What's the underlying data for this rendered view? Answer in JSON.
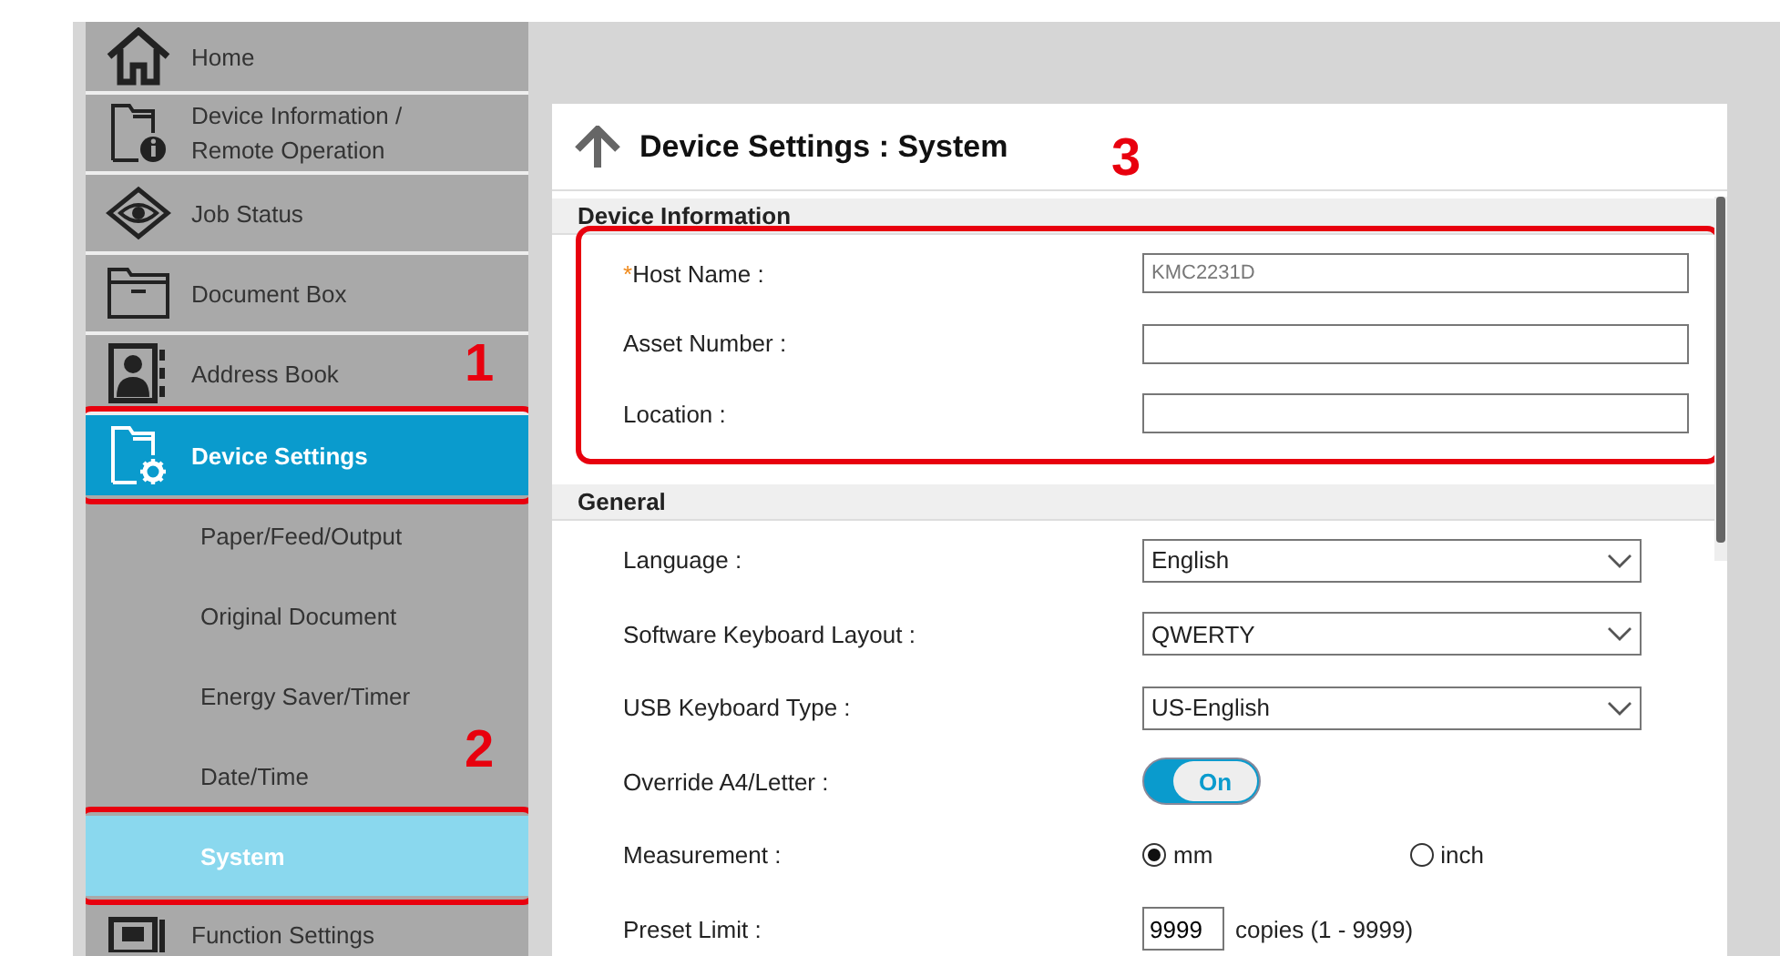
{
  "sidebar": {
    "items": [
      {
        "label": "Home",
        "selected": false
      },
      {
        "label": "Device Information / Remote Operation",
        "selected": false
      },
      {
        "label": "Job Status",
        "selected": false
      },
      {
        "label": "Document Box",
        "selected": false
      },
      {
        "label": "Address Book",
        "selected": false
      },
      {
        "label": "Device Settings",
        "selected": true,
        "callout": "1",
        "children": [
          {
            "label": "Paper/Feed/Output",
            "selected": false
          },
          {
            "label": "Original Document",
            "selected": false
          },
          {
            "label": "Energy Saver/Timer",
            "selected": false
          },
          {
            "label": "Date/Time",
            "selected": false
          },
          {
            "label": "System",
            "selected": true,
            "callout": "2"
          }
        ]
      },
      {
        "label": "Function Settings",
        "selected": false
      }
    ]
  },
  "panel": {
    "title": "Device Settings : System",
    "sections": [
      {
        "title": "Device Information",
        "callout": "3",
        "rows": [
          {
            "kind": "text",
            "label": "Host Name :",
            "required_mark": "*",
            "value": "KMC2231D"
          },
          {
            "kind": "text",
            "label": "Asset Number :"
          },
          {
            "kind": "text",
            "label": "Location :"
          }
        ]
      },
      {
        "title": "General",
        "rows": [
          {
            "kind": "select",
            "label": "Language :",
            "value": "English"
          },
          {
            "kind": "select",
            "label": "Software Keyboard Layout :",
            "value": "QWERTY"
          },
          {
            "kind": "select",
            "label": "USB Keyboard Type :",
            "value": "US-English"
          },
          {
            "kind": "toggle",
            "label": "Override A4/Letter :",
            "on": true,
            "text": "On"
          },
          {
            "kind": "radio",
            "label": "Measurement :",
            "options": [
              {
                "label": "mm",
                "selected": true
              },
              {
                "label": "inch",
                "selected": false
              }
            ]
          },
          {
            "kind": "number",
            "label": "Preset Limit :",
            "value": "9999",
            "suffix": "copies (1 - 9999)"
          }
        ]
      }
    ]
  }
}
